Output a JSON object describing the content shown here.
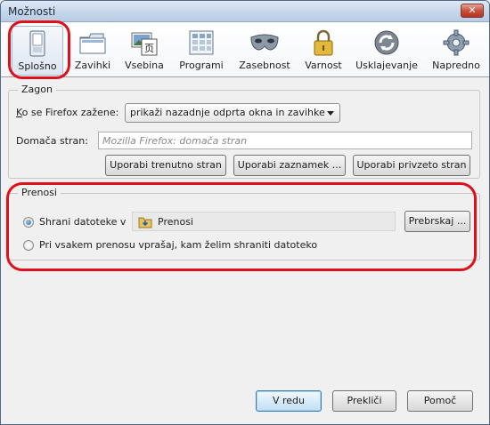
{
  "window": {
    "title": "Možnosti",
    "close_label": "✕"
  },
  "toolbar": {
    "items": [
      {
        "label": "Splošno",
        "icon": "general-switch-icon"
      },
      {
        "label": "Zavihki",
        "icon": "tabs-icon"
      },
      {
        "label": "Vsebina",
        "icon": "content-icon"
      },
      {
        "label": "Programi",
        "icon": "applications-icon"
      },
      {
        "label": "Zasebnost",
        "icon": "privacy-mask-icon"
      },
      {
        "label": "Varnost",
        "icon": "security-lock-icon"
      },
      {
        "label": "Usklajevanje",
        "icon": "sync-icon"
      },
      {
        "label": "Napredno",
        "icon": "advanced-gear-icon"
      }
    ],
    "selected": "Splošno"
  },
  "startup": {
    "legend": "Zagon",
    "when_label": "Ko se Firefox zažene:",
    "when_value": "prikaži nazadnje odprta okna in zavihke",
    "home_label": "Domača stran:",
    "home_placeholder": "Mozilla Firefox: domača stran",
    "btn_current": "Uporabi trenutno stran",
    "btn_bookmark": "Uporabi zaznamek ...",
    "btn_default": "Uporabi privzeto stran"
  },
  "downloads": {
    "legend": "Prenosi",
    "save_label": "Shrani datoteke v",
    "save_folder": "Prenosi",
    "browse": "Prebrskaj ...",
    "ask_label": "Pri vsakem prenosu vprašaj, kam želim shraniti datoteko",
    "selected_option": "save"
  },
  "footer": {
    "ok": "V redu",
    "cancel": "Prekliči",
    "help": "Pomoč"
  },
  "colors": {
    "highlight_ring": "#e0101a",
    "default_button_border": "#3c7fb1"
  }
}
